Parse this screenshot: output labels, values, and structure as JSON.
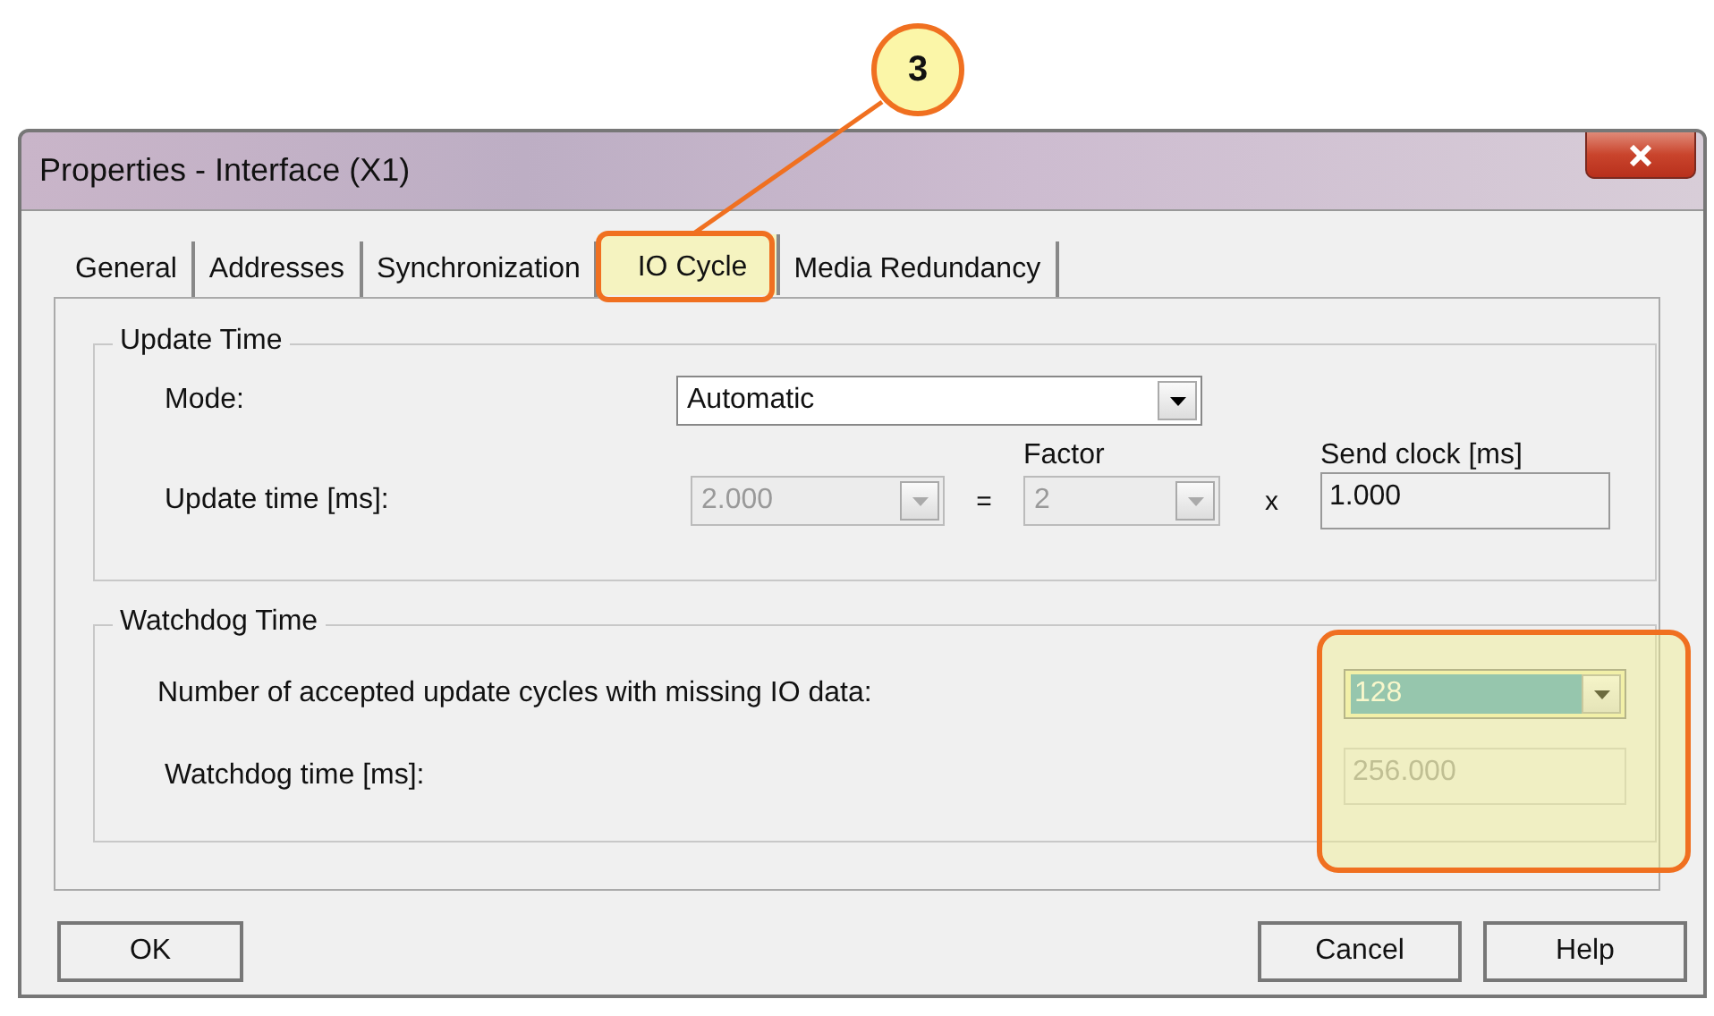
{
  "window": {
    "title": "Properties - Interface (X1)"
  },
  "tabs": [
    {
      "label": "General",
      "selected": false
    },
    {
      "label": "Addresses",
      "selected": false
    },
    {
      "label": "Synchronization",
      "selected": false
    },
    {
      "label": "IO Cycle",
      "selected": true
    },
    {
      "label": "Media Redundancy",
      "selected": false
    }
  ],
  "update_time": {
    "title": "Update Time",
    "mode_label": "Mode:",
    "mode_value": "Automatic",
    "update_label": "Update time [ms]:",
    "update_value": "2.000",
    "update_disabled": true,
    "equals": "=",
    "factor_label": "Factor",
    "factor_value": "2",
    "factor_disabled": true,
    "times": "x",
    "send_clock_label": "Send clock [ms]",
    "send_clock_value": "1.000"
  },
  "watchdog_time": {
    "title": "Watchdog Time",
    "cycles_label": "Number of accepted update cycles with missing IO data:",
    "cycles_value": "128",
    "cycles_selected": true,
    "watchdog_label": "Watchdog time [ms]:",
    "watchdog_value": "256.000",
    "watchdog_disabled": true
  },
  "buttons": [
    {
      "label": "OK"
    },
    {
      "label": "Cancel"
    },
    {
      "label": "Help"
    }
  ],
  "annotation": {
    "badge": "3"
  }
}
